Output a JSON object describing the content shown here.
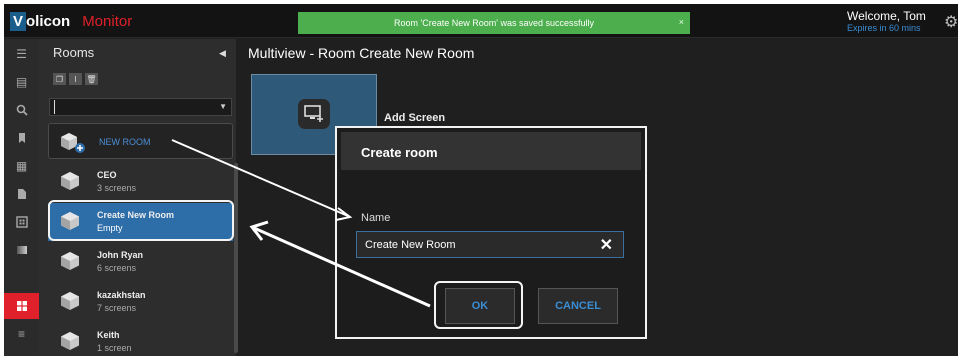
{
  "app": {
    "logo_box": "V",
    "logo_rest": "olicon",
    "product": "Monitor"
  },
  "toast": {
    "message": "Room 'Create New Room' was saved successfully",
    "close": "×"
  },
  "user": {
    "welcome": "Welcome, Tom",
    "expires": "Expires in 60 mins"
  },
  "rooms_panel": {
    "title": "Rooms",
    "filter_value": "",
    "new_room_label": "NEW ROOM",
    "rooms": [
      {
        "name": "CEO",
        "sub": "3 screens"
      },
      {
        "name": "Create New Room",
        "sub": "Empty"
      },
      {
        "name": "John Ryan",
        "sub": "6 screens"
      },
      {
        "name": "kazakhstan",
        "sub": "7 screens"
      },
      {
        "name": "Keith",
        "sub": "1 screen"
      }
    ]
  },
  "main": {
    "title": "Multiview - Room Create New Room",
    "add_screen_label": "Add Screen"
  },
  "modal": {
    "title": "Create room",
    "name_label": "Name",
    "name_value": "Create New Room",
    "ok_label": "OK",
    "cancel_label": "CANCEL"
  },
  "colors": {
    "accent": "#e0202a",
    "selected": "#2d6da8",
    "link": "#3a8ed4",
    "toast": "#4cae4c"
  }
}
